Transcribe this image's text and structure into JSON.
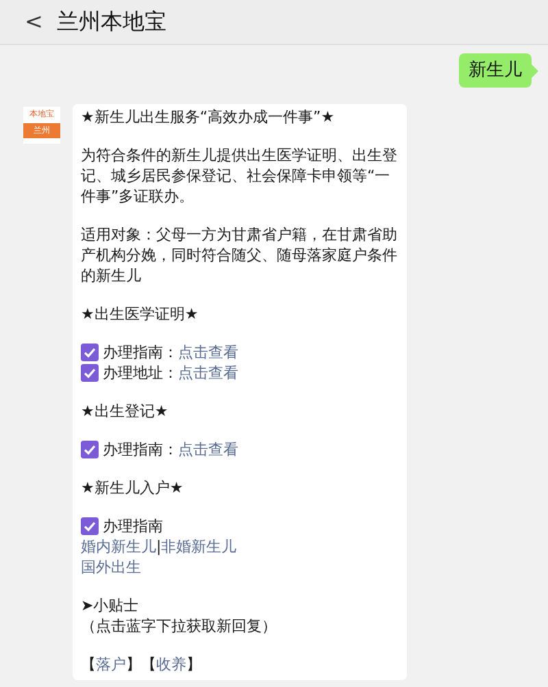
{
  "header": {
    "back": "<",
    "title": "兰州本地宝"
  },
  "sent_message": {
    "text": "新生儿"
  },
  "avatar": {
    "top": "本地宝",
    "bottom": "兰州"
  },
  "reply": [
    {
      "kind": "heading",
      "text": "★新生儿出生服务“高效办成一件事”★"
    },
    {
      "kind": "paragraph",
      "text": "为符合条件的新生儿提供出生医学证明、出生登记、城乡居民参保登记、社会保障卡申领等“一件事”多证联办。"
    },
    {
      "kind": "paragraph",
      "text": "适用对象：父母一方为甘肃省户籍，在甘肃省助产机构分娩，同时符合随父、随母落家庭户条件的新生儿"
    },
    {
      "kind": "heading",
      "text": "★出生医学证明★"
    },
    {
      "kind": "checklist",
      "items": [
        {
          "label": "办理指南：",
          "link": "点击查看"
        },
        {
          "label": "办理地址：",
          "link": "点击查看"
        }
      ]
    },
    {
      "kind": "heading",
      "text": "★出生登记★"
    },
    {
      "kind": "checklist",
      "items": [
        {
          "label": "办理指南：",
          "link": "点击查看"
        }
      ]
    },
    {
      "kind": "heading",
      "text": "★新生儿入户★"
    },
    {
      "kind": "checklist",
      "items": [
        {
          "label": "办理指南"
        }
      ],
      "link_lines": [
        [
          "婚内新生儿",
          "非婚新生儿"
        ],
        [
          "国外出生"
        ]
      ],
      "separator": "|"
    },
    {
      "kind": "tip",
      "title": "➤小贴士",
      "note": "（点击蓝字下拉获取新回复）"
    },
    {
      "kind": "bracket_links",
      "open": "【",
      "close": "】",
      "links": [
        "落户",
        "收养"
      ]
    }
  ]
}
